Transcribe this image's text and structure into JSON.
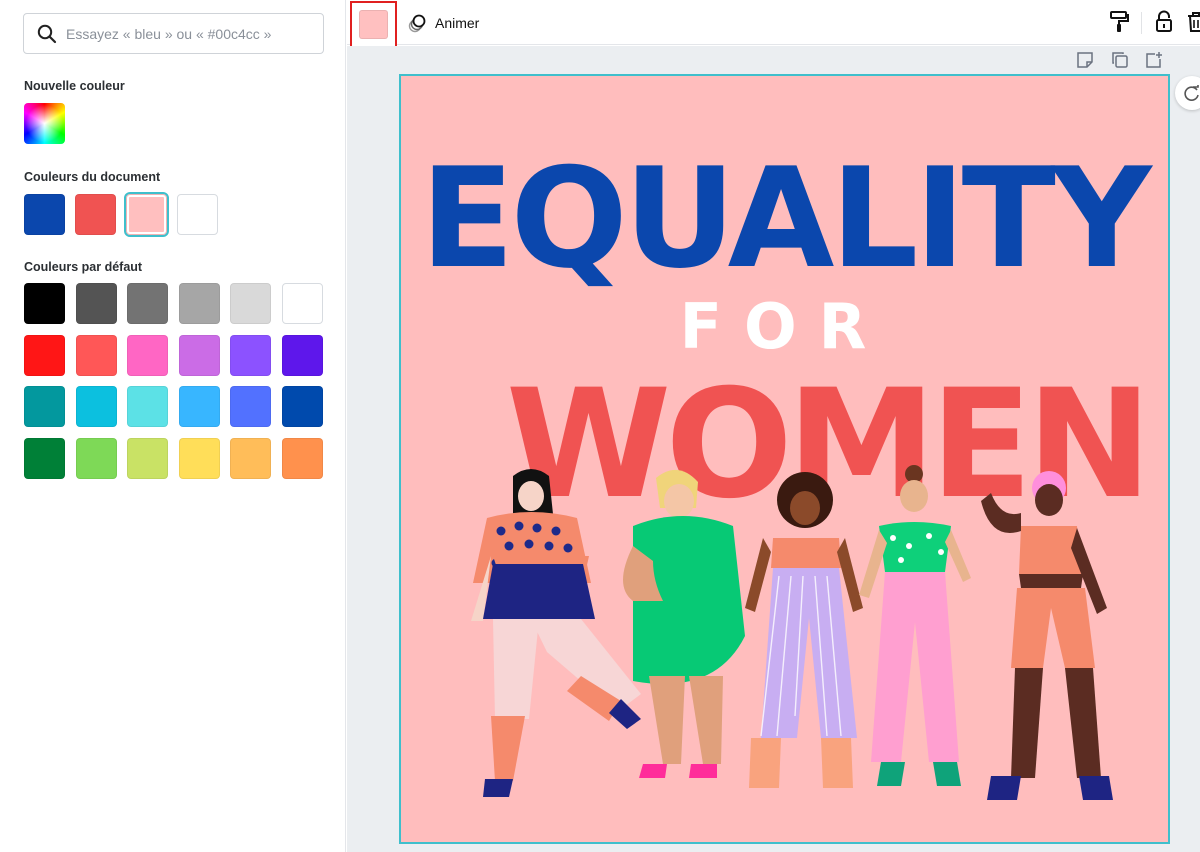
{
  "search": {
    "placeholder": "Essayez « bleu » ou « #00c4cc »"
  },
  "sections": {
    "new_color": "Nouvelle couleur",
    "document_colors": "Couleurs du document",
    "default_colors": "Couleurs par défaut"
  },
  "document_colors": [
    "#0b47ad",
    "#f05352",
    "#ffbfbf",
    "#ffffff"
  ],
  "selected_document_color": 2,
  "default_colors": [
    [
      "#000000",
      "#545454",
      "#737373",
      "#a6a6a6",
      "#d9d9d9",
      "#ffffff"
    ],
    [
      "#ff1616",
      "#ff5757",
      "#ff66c4",
      "#cb6ce6",
      "#8c52ff",
      "#5e17eb"
    ],
    [
      "#03989e",
      "#0cc0df",
      "#5ce1e6",
      "#38b6ff",
      "#5271ff",
      "#004aad"
    ],
    [
      "#008037",
      "#7ed957",
      "#c9e265",
      "#ffde59",
      "#ffbd59",
      "#ff914d"
    ]
  ],
  "toolbar": {
    "current_color": "#ffc0c0",
    "animate_label": "Animer"
  },
  "design": {
    "background": "#ffbdbd",
    "title_line1": "EQUALITY",
    "title_line2": "FOR",
    "title_line3": "WOMEN",
    "accent_blue": "#0b47ad",
    "accent_red": "#f05352"
  },
  "icons": {
    "search": "search-icon",
    "animate": "animate-icon",
    "paint_roller": "copy-style-icon",
    "lock": "lock-icon",
    "trash": "trash-icon",
    "note": "note-icon",
    "duplicate": "duplicate-icon",
    "add_page": "add-page-icon",
    "rotate": "rotate-icon"
  }
}
